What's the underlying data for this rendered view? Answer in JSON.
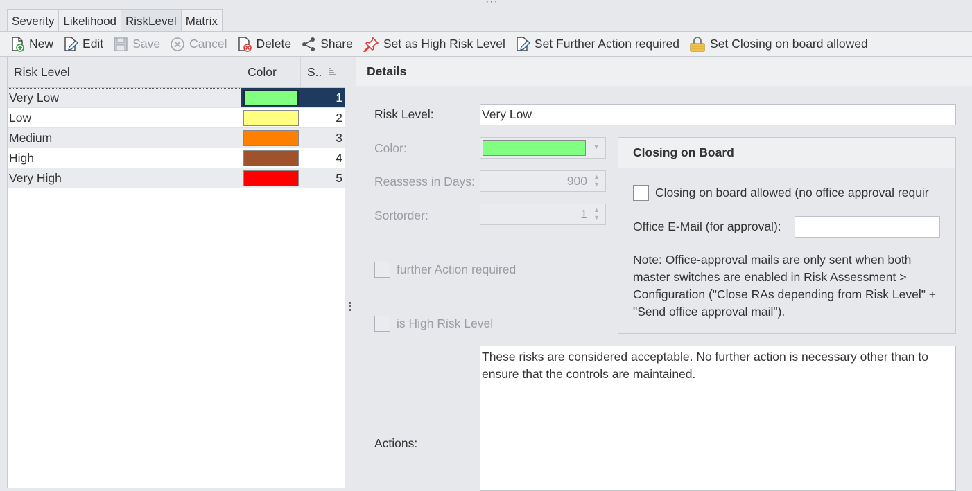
{
  "tabs": [
    {
      "label": "Severity"
    },
    {
      "label": "Likelihood"
    },
    {
      "label": "RiskLevel"
    },
    {
      "label": "Matrix"
    }
  ],
  "toolbar": {
    "new": "New",
    "edit": "Edit",
    "save": "Save",
    "cancel": "Cancel",
    "delete": "Delete",
    "share": "Share",
    "set_high": "Set as High Risk Level",
    "set_further": "Set Further Action required",
    "set_closing": "Set Closing on board allowed"
  },
  "grid": {
    "headers": {
      "risk_level": "Risk Level",
      "color": "Color",
      "sort": "S.."
    },
    "rows": [
      {
        "name": "Very Low",
        "color": "#80ff80",
        "order": "1"
      },
      {
        "name": "Low",
        "color": "#ffff80",
        "order": "2"
      },
      {
        "name": "Medium",
        "color": "#ff8000",
        "order": "3"
      },
      {
        "name": "High",
        "color": "#a0522d",
        "order": "4"
      },
      {
        "name": "Very High",
        "color": "#ff0000",
        "order": "5"
      }
    ]
  },
  "details": {
    "title": "Details",
    "risk_level_label": "Risk Level:",
    "risk_level_value": "Very Low",
    "color_label": "Color:",
    "color_value": "#80ff80",
    "reassess_label": "Reassess in Days:",
    "reassess_value": "900",
    "sortorder_label": "Sortorder:",
    "sortorder_value": "1",
    "further_action_label": "further Action required",
    "high_risk_label": "is High Risk Level",
    "actions_label": "Actions:",
    "actions_text": "These risks are considered acceptable. No further action is necessary other than to ensure that the controls are maintained."
  },
  "closing_on_board": {
    "title": "Closing on Board",
    "allowed_label": "Closing on board allowed (no office approval requir",
    "email_label": "Office E-Mail (for approval):",
    "email_value": "",
    "note": "Note: Office-approval mails are only sent when both master switches are enabled in Risk Assessment > Configuration (\"Close RAs depending from Risk Level\" + \"Send office approval mail\")."
  }
}
